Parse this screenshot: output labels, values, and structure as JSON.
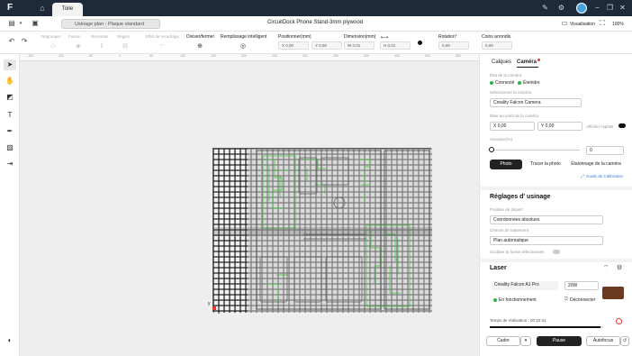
{
  "titlebar": {
    "tab": "Toile",
    "visualisation": "Visualisation",
    "zoom": "100%"
  },
  "toolbar": {
    "material_select": "Usinage plan - Plaque standard",
    "document_title": "CircuitDock Phone Stand-3mm plywood"
  },
  "ribbon": {
    "items": [
      "Regrouper",
      "Fusion",
      "Remonter",
      "Réglés",
      "Effet de recadrage"
    ],
    "diviser": "Diviser/fermer",
    "remplissage": "Remplissage intelligent",
    "positionner": "Positionner(mm)",
    "pos_x": "X 0,00",
    "pos_y": "Y 0,00",
    "dimension": "Dimension(mm)",
    "dim_w": "W 0,01",
    "dim_h": "H 0,01",
    "rotation": "Rotation°",
    "rot_val": "0,00",
    "coins": "Coins arrondis",
    "coins_val": "0,00"
  },
  "ruler_ticks": [
    "-150",
    "-100",
    "-50",
    "0",
    "50",
    "100",
    "150",
    "200",
    "250",
    "300",
    "350",
    "400",
    "450",
    "500",
    "550",
    "600"
  ],
  "canvas": {
    "axis_y": "y",
    "axis_x": "x"
  },
  "right_panel": {
    "tab_calques": "Calques",
    "tab_camera": "Caméra",
    "etat_label": "État de la caméra",
    "status_connecte": "Connecté",
    "status_eteindre": "Éteindre",
    "select_camera_label": "Sélectionner la caméra",
    "camera_value": "Creality Falcon Camera",
    "focus_label": "Mise au point de la caméra",
    "focus_x": "X 0,00",
    "focus_y": "Y 0,00",
    "afficher_label": "Afficher l'aplats",
    "zoom_label": "Assorper(%)",
    "zoom_value": "0",
    "btn_photo": "Photo",
    "btn_tracer": "Tracer la photo",
    "btn_etalonnage": "Étalonnage de la caméra",
    "guide_link": "Guide de Calibration",
    "usinage_title": "Réglages d' usinage",
    "position_label": "Position de départ",
    "position_value": "Coordonnées absolues",
    "chemin_label": "Chemin de traitement",
    "chemin_value": "Plan automatique",
    "sculpter_label": "Sculpter la forme sélectionnée",
    "laser_title": "Laser",
    "laser_model": "Creality Falcon A1 Pro",
    "laser_power": "20W",
    "laser_status": "En fonctionnement",
    "btn_deconnecter": "Déconnecter",
    "temps_label": "Temps de réalisation : 00:10:31",
    "btn_cadre": "Cadre",
    "btn_pause": "Pause",
    "btn_autofocus": "Autofocus"
  },
  "colors": {
    "accent": "#2bb24c",
    "titlebar": "#1e2a3a",
    "engrave_green": "#3cc23c"
  }
}
